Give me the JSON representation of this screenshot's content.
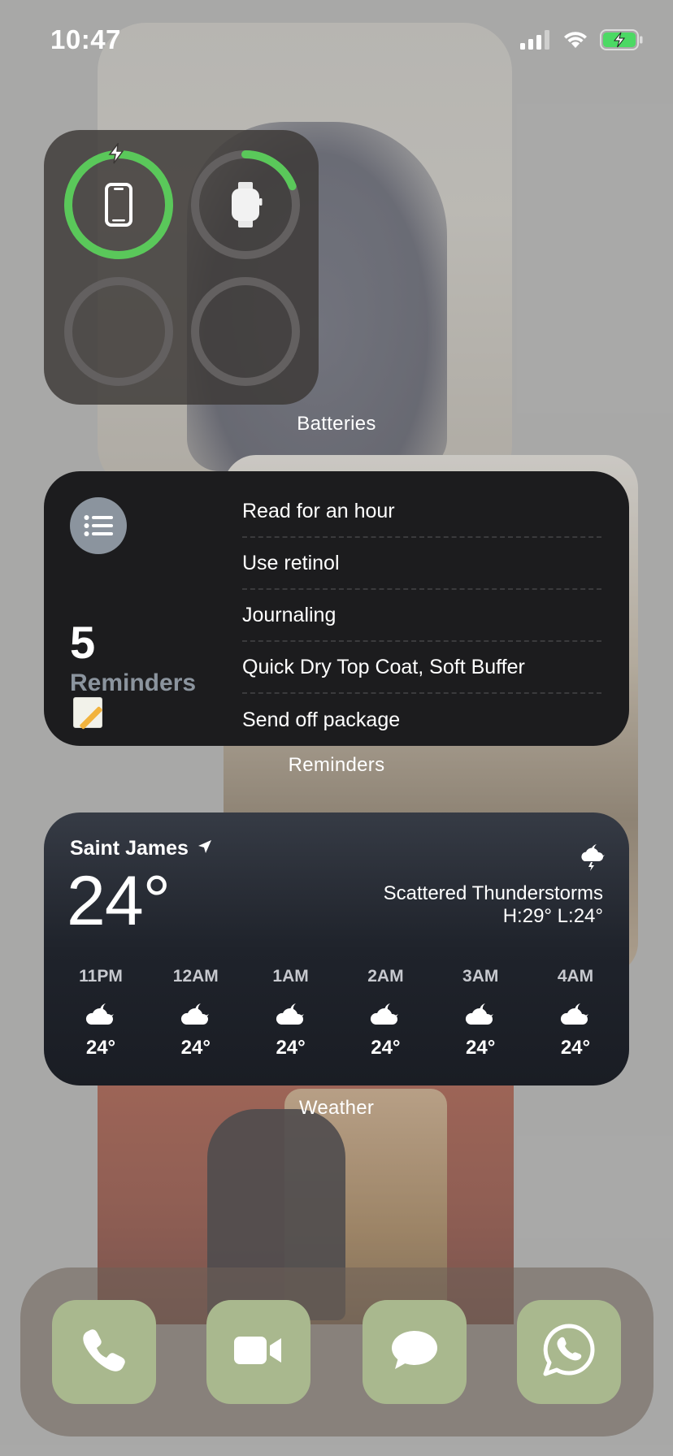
{
  "status_bar": {
    "time": "10:47",
    "icons": [
      "signal-icon",
      "wifi-icon",
      "battery-charging-icon"
    ]
  },
  "batteries": {
    "caption": "Batteries",
    "devices": [
      {
        "icon": "iphone-icon",
        "level": 1.0,
        "charging": true
      },
      {
        "icon": "apple-watch-icon",
        "level": 0.19,
        "charging": false
      },
      {
        "icon": "empty-slot",
        "level": 0,
        "charging": false
      },
      {
        "icon": "empty-slot",
        "level": 0,
        "charging": false
      }
    ],
    "accent": "#5ac85a"
  },
  "reminders": {
    "caption": "Reminders",
    "count": "5",
    "label": "Reminders",
    "icon": "list-bullet-icon",
    "items": [
      "Read for an hour",
      "Use retinol",
      "Journaling",
      "Quick Dry Top Coat, Soft Buffer",
      "Send off package"
    ]
  },
  "weather": {
    "caption": "Weather",
    "city": "Saint James",
    "temp": "24°",
    "condition": "Scattered Thunderstorms",
    "hilo": "H:29° L:24°",
    "hourly": [
      {
        "time": "11PM",
        "icon": "cloud-moon-icon",
        "temp": "24°"
      },
      {
        "time": "12AM",
        "icon": "cloud-moon-icon",
        "temp": "24°"
      },
      {
        "time": "1AM",
        "icon": "cloud-moon-icon",
        "temp": "24°"
      },
      {
        "time": "2AM",
        "icon": "cloud-moon-icon",
        "temp": "24°"
      },
      {
        "time": "3AM",
        "icon": "cloud-moon-icon",
        "temp": "24°"
      },
      {
        "time": "4AM",
        "icon": "cloud-moon-icon",
        "temp": "24°"
      }
    ]
  },
  "dock": {
    "apps": [
      "phone-icon",
      "facetime-icon",
      "messages-icon",
      "whatsapp-icon"
    ],
    "tile_color": "#a9b88e"
  }
}
